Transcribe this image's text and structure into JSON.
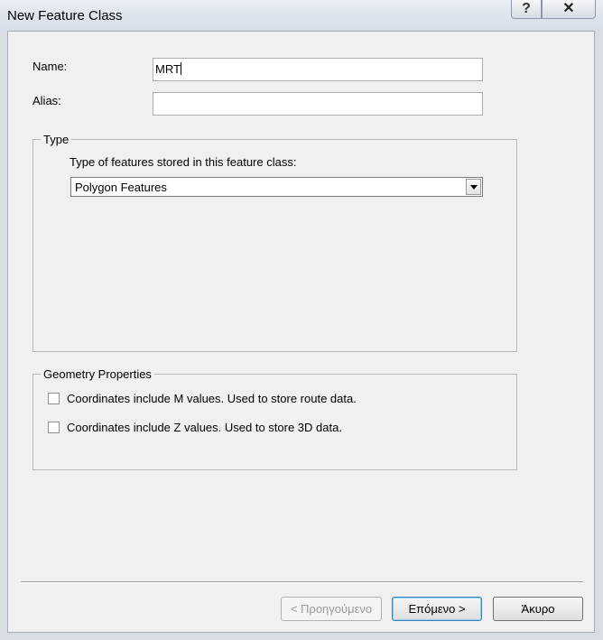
{
  "window": {
    "title": "New Feature Class",
    "help_glyph": "?",
    "close_glyph": "✕"
  },
  "form": {
    "name_label": "Name:",
    "name_value": "MRT",
    "alias_label": "Alias:",
    "alias_value": ""
  },
  "type_group": {
    "legend": "Type",
    "prompt": "Type of features stored in this feature class:",
    "selected": "Polygon Features"
  },
  "geometry_group": {
    "legend": "Geometry Properties",
    "options": [
      {
        "label": "Coordinates include M values. Used to store route data.",
        "checked": false
      },
      {
        "label": "Coordinates include Z values. Used to store 3D data.",
        "checked": false
      }
    ]
  },
  "buttons": {
    "back": "< Προηγούμενο",
    "next": "Επόμενο >",
    "cancel": "Άκυρο"
  }
}
